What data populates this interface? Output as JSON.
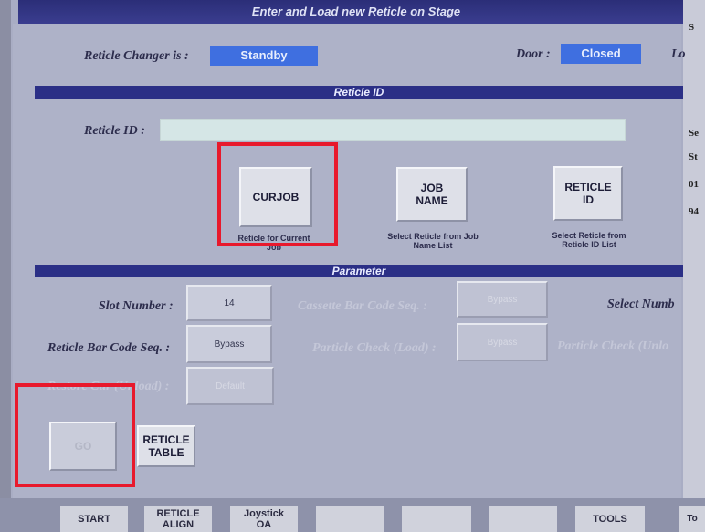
{
  "header": {
    "title": "Enter and Load new Reticle on Stage"
  },
  "status_row": {
    "changer_label": "Reticle Changer is :",
    "changer_value": "Standby",
    "door_label": "Door :",
    "door_value": "Closed",
    "cut_label": "Lo"
  },
  "reticle_id_section": {
    "band": "Reticle ID",
    "id_label": "Reticle ID :",
    "id_value": ""
  },
  "selectors": [
    {
      "label": "CURJOB",
      "caption": "Reticle for Current Job"
    },
    {
      "label": "JOB NAME",
      "caption": "Select Reticle from Job Name List"
    },
    {
      "label": "RETICLE ID",
      "caption": "Select Reticle from Reticle ID List"
    }
  ],
  "parameter_section": {
    "band": "Parameter",
    "slot_label": "Slot Number :",
    "slot_value": "14",
    "cassette_label": "Cassette Bar Code Seq. :",
    "cassette_value": "Bypass",
    "select_num_label": "Select Numb",
    "reticle_bar_label": "Reticle Bar Code Seq. :",
    "reticle_bar_value": "Bypass",
    "particle_load_label": "Particle Check (Load) :",
    "particle_load_value": "Bypass",
    "particle_unload_label": "Particle Check (Unlo",
    "restore_label": "Restore Cur (Unload) :",
    "restore_value": "Default"
  },
  "actions": {
    "go": "GO",
    "reticle_table": "RETICLE TABLE"
  },
  "right_panel": {
    "t1": "Se",
    "t2": "St",
    "t3": "01",
    "t4": "94",
    "t5": "S"
  },
  "toolbar": {
    "start": "START",
    "reticle_align": "RETICLE ALIGN",
    "joystick": "Joystick OA",
    "tools": "TOOLS",
    "tail": "To"
  },
  "colors": {
    "highlight": "#e8192c",
    "band": "#2b2f86",
    "status": "#3f6fe0"
  }
}
